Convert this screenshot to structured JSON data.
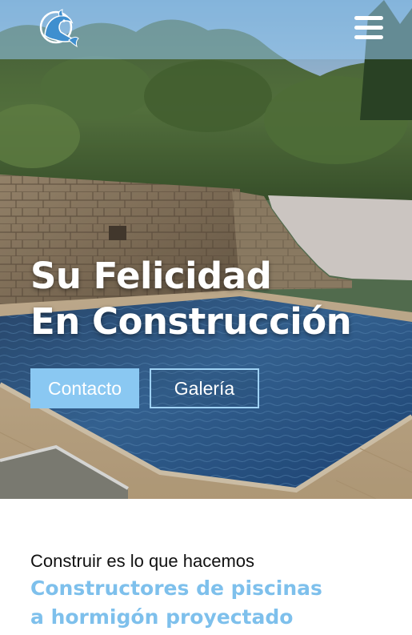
{
  "header": {
    "logo_icon": "dolphin-logo-icon",
    "menu_icon": "hamburger-menu-icon"
  },
  "hero": {
    "title_line1": "Su Felicidad",
    "title_line2": "En Construcción",
    "contact_label": "Contacto",
    "gallery_label": "Galería"
  },
  "section": {
    "intro": "Construir es lo que hacemos",
    "heading_line1": "Constructores de piscinas",
    "heading_line2": "a hormigón proyectado"
  },
  "colors": {
    "accent": "#8ac8f2",
    "heading": "#7ec0ec",
    "header_overlay": "#96c8f0"
  }
}
